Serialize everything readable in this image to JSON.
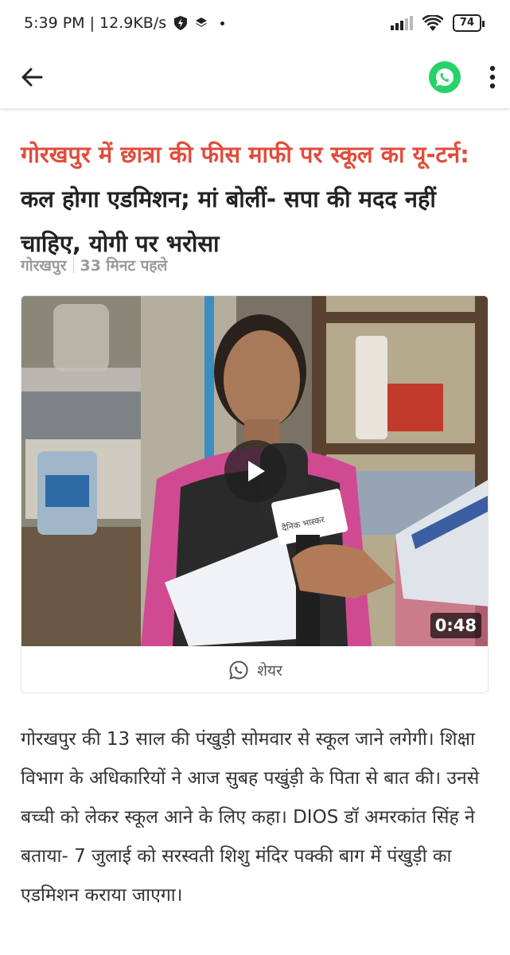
{
  "status_bar": {
    "time_speed": "5:39 PM | 12.9KB/s",
    "battery": "74"
  },
  "app_bar": {
    "back_icon": "arrow-left-icon",
    "share_icon": "whatsapp-icon",
    "menu_icon": "more-vertical-icon",
    "whatsapp_color": "#25d366"
  },
  "article": {
    "headline_kicker": "गोरखपुर में छात्रा की फीस माफी पर स्कूल का यू-टर्न:",
    "headline_rest": " कल होगा एडमिशन; मां बोलीं- सपा की मदद नहीं चाहिए, योगी पर भरोसा",
    "kicker_color": "#e24b3b",
    "location": "गोरखपुर",
    "time_ago": "33 मिनट पहले",
    "video": {
      "duration": "0:48",
      "mic_logo_text": "दैनिक भास्कर"
    },
    "share_label": "शेयर",
    "body": "गोरखपुर की 13 साल की पंखुड़ी सोमवार से स्कूल जाने लगेगी। शिक्षा विभाग के अधिकारियों ने आज सुबह पखुंड़ी के पिता से बात की। उनसे बच्ची को लेकर स्कूल आने के लिए कहा। DIOS डॉ अमरकांत सिंह ने बताया- 7 जुलाई को सरस्वती शिशु मंदिर पक्की बाग में पंखुड़ी का एडमिशन कराया जाएगा।"
  }
}
